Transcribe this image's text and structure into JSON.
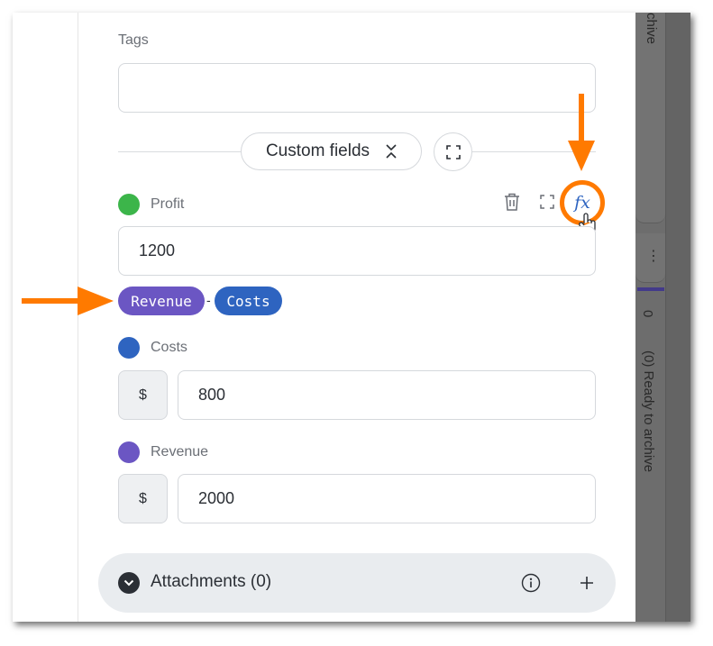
{
  "tags": {
    "label": "Tags",
    "value": ""
  },
  "custom_fields": {
    "label": "Custom fields"
  },
  "profit": {
    "label": "Profit",
    "value": "1200",
    "color": "#3cb54a",
    "formula": {
      "left": "Revenue",
      "operator": "-",
      "right": "Costs"
    },
    "formula_button": "fx"
  },
  "costs": {
    "label": "Costs",
    "prefix": "$",
    "value": "800",
    "color": "#2e64c0"
  },
  "revenue": {
    "label": "Revenue",
    "prefix": "$",
    "value": "2000",
    "color": "#6b56c3"
  },
  "attachments": {
    "label": "Attachments (0)"
  },
  "side": {
    "top_text": "chive",
    "dots": "⋮",
    "count": "0",
    "column_title": "(0) Ready to archive"
  },
  "colors": {
    "accent_orange": "#ff7a00",
    "revenue_tag": "#6b56c3",
    "costs_tag": "#2e64c0"
  }
}
